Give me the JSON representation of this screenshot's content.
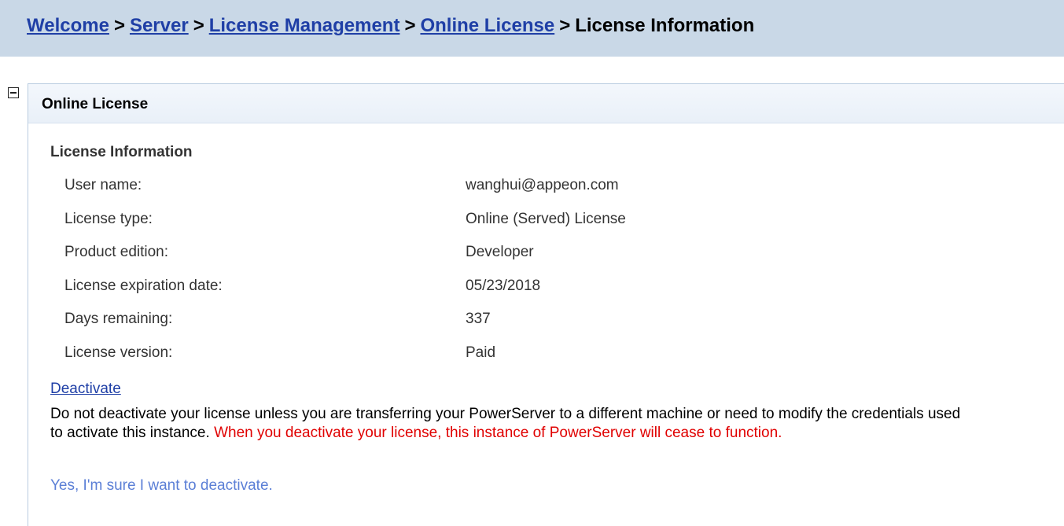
{
  "breadcrumb": {
    "items": [
      "Welcome",
      "Server",
      "License Management",
      "Online License"
    ],
    "separator": ">",
    "current": "License Information"
  },
  "panel": {
    "title": "Online License",
    "section_title": "License Information",
    "rows": [
      {
        "label": "User name:",
        "value": "wanghui@appeon.com"
      },
      {
        "label": "License type:",
        "value": "Online (Served) License"
      },
      {
        "label": "Product edition:",
        "value": "Developer"
      },
      {
        "label": "License expiration date:",
        "value": "05/23/2018"
      },
      {
        "label": "Days remaining:",
        "value": "337"
      },
      {
        "label": "License version:",
        "value": "Paid"
      }
    ],
    "deactivate_link": "Deactivate",
    "warning_text": "Do not deactivate your license unless you are transferring your PowerServer to a different machine or need to modify the credentials used to activate this instance. ",
    "warning_emphasis": "When you deactivate your license, this instance of PowerServer will cease to function.",
    "confirm_link": "Yes, I'm sure I want to deactivate."
  },
  "icons": {
    "collapse": "collapse-minus-icon"
  },
  "colors": {
    "breadcrumb_bg": "#c9d8e7",
    "link": "#1f3fa6",
    "warning_red": "#e00000",
    "confirm_link": "#5b7fd6"
  }
}
